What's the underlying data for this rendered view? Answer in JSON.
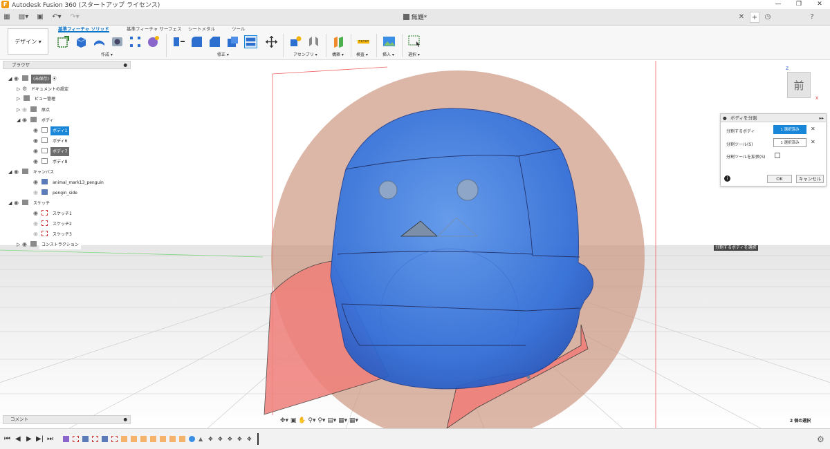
{
  "window": {
    "title": "Autodesk Fusion 360 (スタートアップ ライセンス)",
    "logo": "F",
    "minimize": "—",
    "maximize": "❐",
    "close": "✕"
  },
  "tabstrip": {
    "document_title": "無題*",
    "close_tab": "✕",
    "new_tab": "+",
    "clock_icon": "◷",
    "help_icon": "?"
  },
  "toolbar": {
    "workspace": "デザイン ▾",
    "tabs": [
      "基準フィーチャ ソリッド",
      "基準フィーチャ サーフェス",
      "シートメタル",
      "ツール"
    ],
    "active_tab": 0,
    "groups": [
      "作成 ▾",
      "修正 ▾",
      "アセンブリ ▾",
      "構築 ▾",
      "検査 ▾",
      "挿入 ▾",
      "選択 ▾"
    ]
  },
  "browser": {
    "header": "ブラウザ",
    "rows": [
      {
        "label": "(未保存)",
        "style": "dark"
      },
      {
        "label": "ドキュメントの設定",
        "style": ""
      },
      {
        "label": "ビュー管理",
        "style": ""
      },
      {
        "label": "原点",
        "style": ""
      },
      {
        "label": "ボディ",
        "style": ""
      },
      {
        "label": "ボディ1",
        "style": "sel"
      },
      {
        "label": "ボディ6",
        "style": ""
      },
      {
        "label": "ボディ7",
        "style": "dark"
      },
      {
        "label": "ボディ8",
        "style": ""
      },
      {
        "label": "キャンバス",
        "style": ""
      },
      {
        "label": "animal_mark13_penguin",
        "style": ""
      },
      {
        "label": "pengin_side",
        "style": ""
      },
      {
        "label": "スケッチ",
        "style": ""
      },
      {
        "label": "スケッチ1",
        "style": ""
      },
      {
        "label": "スケッチ2",
        "style": ""
      },
      {
        "label": "スケッチ3",
        "style": ""
      },
      {
        "label": "コンストラクション",
        "style": ""
      }
    ]
  },
  "comment": {
    "label": "コメント"
  },
  "dialog": {
    "title": "ボディを分割",
    "row1_label": "分割するボディ",
    "row1_value": "1 選択済み",
    "row2_label": "分割ツール(S)",
    "row2_value": "1 選択済み",
    "row3_label": "分割ツールを拡張(S)",
    "info_icon": "i",
    "ok": "OK",
    "cancel": "キャンセル"
  },
  "viewcube": {
    "face": "前",
    "z": "Z",
    "x": "X"
  },
  "viewport": {
    "hint": "分割するボディを選択",
    "selection_count": "2 個の選択"
  },
  "navbar": {
    "icons": "✥▾ ▣ ✋ ⚲▾ ⚲▾ ▤▾ ▦▾ ▦▾"
  },
  "timeline": {
    "controls": [
      "⏮",
      "◀",
      "▶",
      "▶|",
      "⏭"
    ]
  },
  "colors": {
    "accent": "#1a86d8",
    "body_blue": "#2f6fdc",
    "canvas_brown": "#c9907a",
    "surface_red": "#f07f7a"
  }
}
